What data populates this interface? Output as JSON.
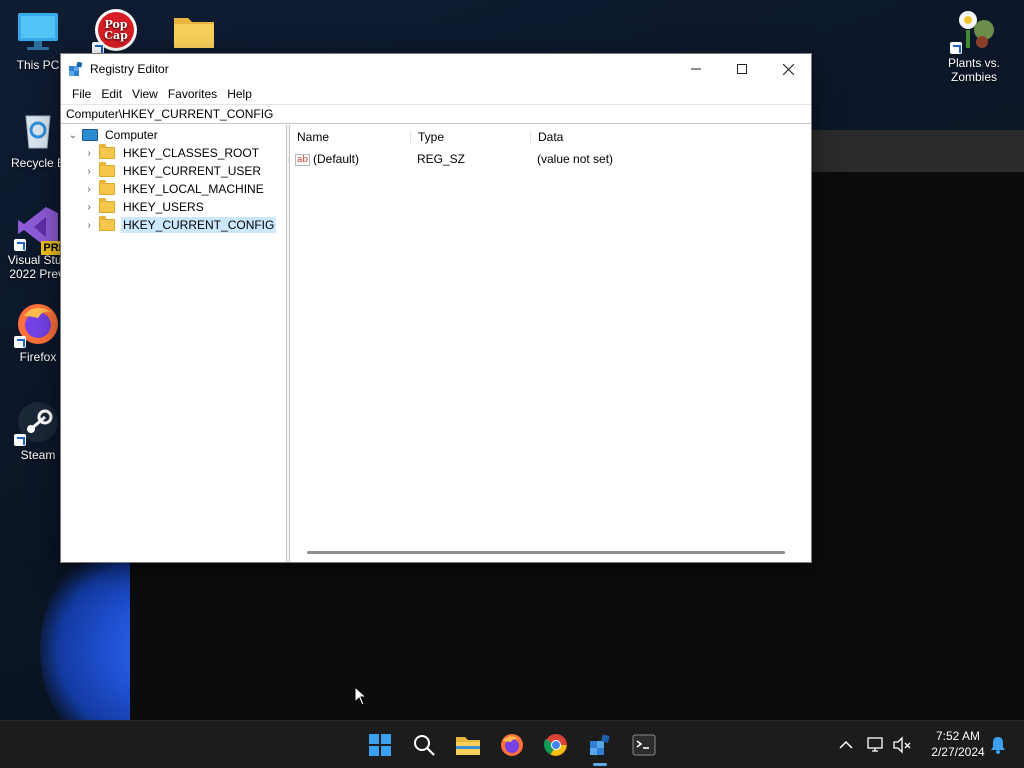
{
  "desktop": {
    "icons": [
      {
        "label": "This PC",
        "icon": "monitor-icon"
      },
      {
        "label": "",
        "icon": "popcap-icon"
      },
      {
        "label": "",
        "icon": "folder-icon"
      },
      {
        "label": "Recycle B",
        "icon": "recycle-bin-icon"
      },
      {
        "label": "Visual Stud 2022 Previ",
        "icon": "visual-studio-icon",
        "badge": "PRE"
      },
      {
        "label": "Firefox",
        "icon": "firefox-icon"
      },
      {
        "label": "Steam",
        "icon": "steam-icon"
      },
      {
        "label": "Plants vs. Zombies",
        "icon": "pvz-icon"
      }
    ]
  },
  "regedit": {
    "title": "Registry Editor",
    "menu": [
      "File",
      "Edit",
      "View",
      "Favorites",
      "Help"
    ],
    "address": "Computer\\HKEY_CURRENT_CONFIG",
    "tree": {
      "root": "Computer",
      "children": [
        "HKEY_CLASSES_ROOT",
        "HKEY_CURRENT_USER",
        "HKEY_LOCAL_MACHINE",
        "HKEY_USERS",
        "HKEY_CURRENT_CONFIG"
      ],
      "selected": "HKEY_CURRENT_CONFIG"
    },
    "columns": [
      "Name",
      "Type",
      "Data"
    ],
    "rows": [
      {
        "name": "(Default)",
        "type": "REG_SZ",
        "data": "(value not set)"
      }
    ]
  },
  "taskbar": {
    "apps": [
      "start-icon",
      "search-icon",
      "file-explorer-icon",
      "firefox-icon",
      "chrome-icon",
      "registry-editor-icon",
      "terminal-icon"
    ],
    "active": "registry-editor-icon",
    "time": "7:52 AM",
    "date": "2/27/2024"
  },
  "colors": {
    "accent": "#0078d4",
    "selection": "#cce8ff",
    "taskbar": "#1c1c1c"
  }
}
